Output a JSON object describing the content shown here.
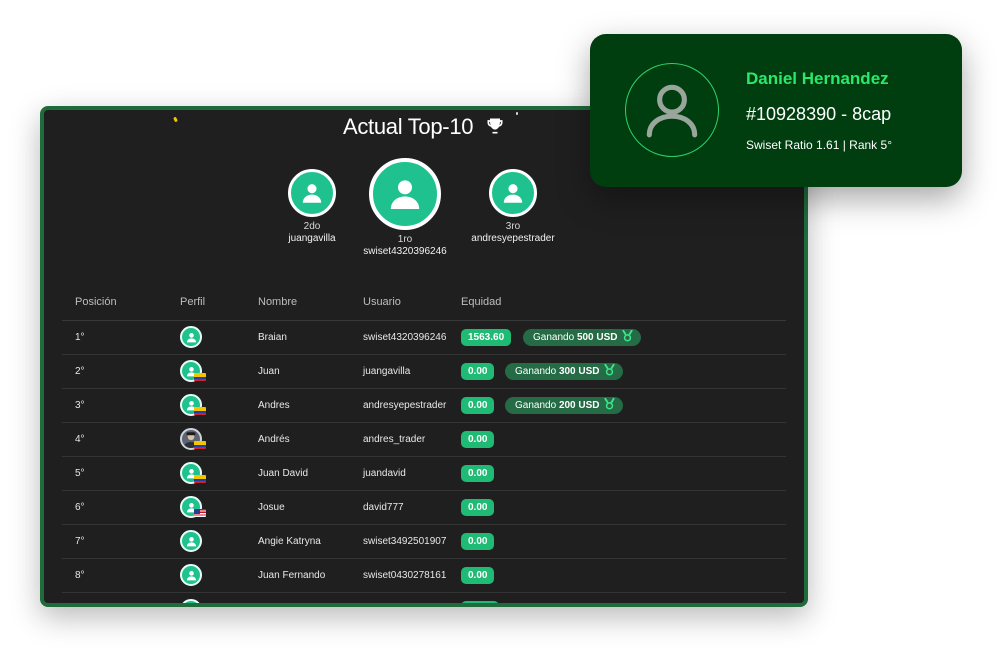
{
  "board": {
    "title": "Actual Top-10",
    "trophy_icon": "trophy-icon",
    "podium": [
      {
        "place": "2do",
        "username": "juangavilla"
      },
      {
        "place": "1ro",
        "username": "swiset4320396246"
      },
      {
        "place": "3ro",
        "username": "andresyepestrader"
      }
    ],
    "columns": {
      "position": "Posición",
      "profile": "Perfil",
      "name": "Nombre",
      "user": "Usuario",
      "equity": "Equidad"
    },
    "rows": [
      {
        "position": "1°",
        "name": "Braian",
        "user": "swiset4320396246",
        "equity": "1563.60",
        "prize_prefix": "Ganando",
        "prize_amount": "500 USD",
        "flag": ""
      },
      {
        "position": "2°",
        "name": "Juan",
        "user": "juangavilla",
        "equity": "0.00",
        "prize_prefix": "Ganando",
        "prize_amount": "300 USD",
        "flag": "co"
      },
      {
        "position": "3°",
        "name": "Andres",
        "user": "andresyepestrader",
        "equity": "0.00",
        "prize_prefix": "Ganando",
        "prize_amount": "200 USD",
        "flag": "co"
      },
      {
        "position": "4°",
        "name": "Andrés",
        "user": "andres_trader",
        "equity": "0.00",
        "flag": "co"
      },
      {
        "position": "5°",
        "name": "Juan David",
        "user": "juandavid",
        "equity": "0.00",
        "flag": "co"
      },
      {
        "position": "6°",
        "name": "Josue",
        "user": "david777",
        "equity": "0.00",
        "flag": "us"
      },
      {
        "position": "7°",
        "name": "Angie Katryna",
        "user": "swiset3492501907",
        "equity": "0.00",
        "flag": ""
      },
      {
        "position": "8°",
        "name": "Juan Fernando",
        "user": "swiset0430278161",
        "equity": "0.00",
        "flag": ""
      }
    ]
  },
  "profile_card": {
    "name": "Daniel Hernandez",
    "id_line": "#10928390 - 8cap",
    "ratio_line": "Swiset Ratio 1.61 | Rank 5°"
  },
  "colors": {
    "accent_green": "#1fc28e",
    "pill_green": "#1fba74",
    "card_green": "#003d0f",
    "name_green": "#2be86a",
    "panel_bg": "#1f1f1f"
  }
}
